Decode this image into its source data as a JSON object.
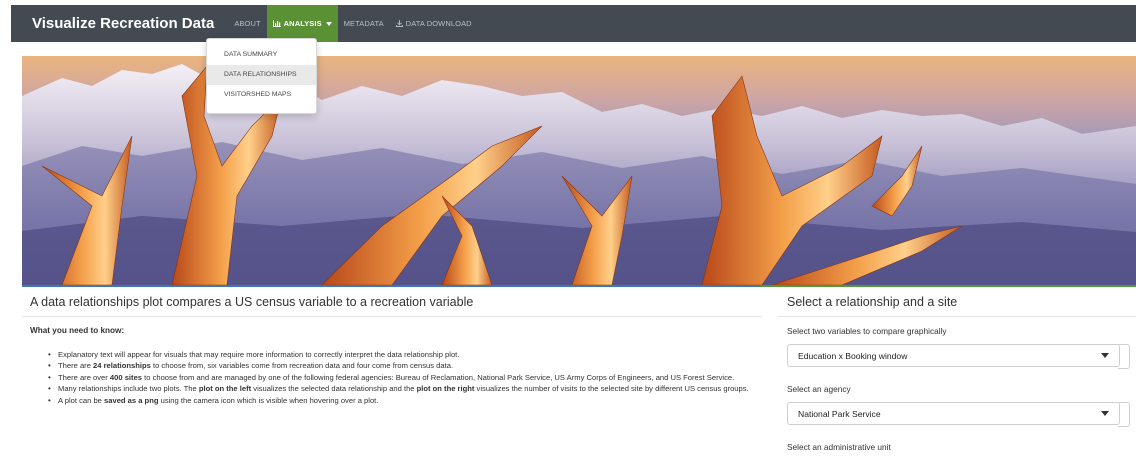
{
  "navbar": {
    "brand": "Visualize Recreation Data",
    "items": [
      {
        "label": "About"
      },
      {
        "label": "Analysis",
        "icon": "bar-chart-icon",
        "active": true
      },
      {
        "label": "Metadata"
      },
      {
        "label": "Data Download",
        "icon": "download-icon"
      }
    ],
    "colors": {
      "background": "#434a52",
      "active": "#5a9135"
    }
  },
  "dropdown": {
    "items": [
      {
        "label": "Data Summary"
      },
      {
        "label": "Data Relationships",
        "hovered": true
      },
      {
        "label": "Visitorshed Maps"
      }
    ]
  },
  "left_panel": {
    "title": "A data relationships plot compares a US census variable to a recreation variable",
    "need_to_know": "What you need to know:",
    "bullets": [
      {
        "parts": [
          {
            "t": "Explanatory text will appear for visuals that may require more information to correctly interpret the data relationship plot."
          }
        ]
      },
      {
        "parts": [
          {
            "t": "There are "
          },
          {
            "t": "24 relationships",
            "b": true
          },
          {
            "t": " to choose from, six variables come from recreation data and four come from census data."
          }
        ]
      },
      {
        "parts": [
          {
            "t": "There are over "
          },
          {
            "t": "400 sites",
            "b": true
          },
          {
            "t": " to choose from and are managed by one of the following federal agencies: Bureau of Reclamation, National Park Service, US Army Corps of Engineers, and US Forest Service."
          }
        ]
      },
      {
        "parts": [
          {
            "t": "Many relationships include two plots. The "
          },
          {
            "t": "plot on the left",
            "b": true
          },
          {
            "t": " visualizes the selected data relationship and the "
          },
          {
            "t": "plot on the right",
            "b": true
          },
          {
            "t": " visualizes the number of visits to the selected site by different US census groups."
          }
        ]
      },
      {
        "parts": [
          {
            "t": "A plot can be "
          },
          {
            "t": "saved as a png",
            "b": true
          },
          {
            "t": " using the camera icon which is visible when hovering over a plot."
          }
        ]
      }
    ]
  },
  "right_panel": {
    "title": "Select a relationship and a site",
    "variables_label": "Select two variables to compare graphically",
    "variables_value": "Education x Booking window",
    "agency_label": "Select an agency",
    "agency_value": "National Park Service",
    "unit_label": "Select an administrative unit"
  }
}
